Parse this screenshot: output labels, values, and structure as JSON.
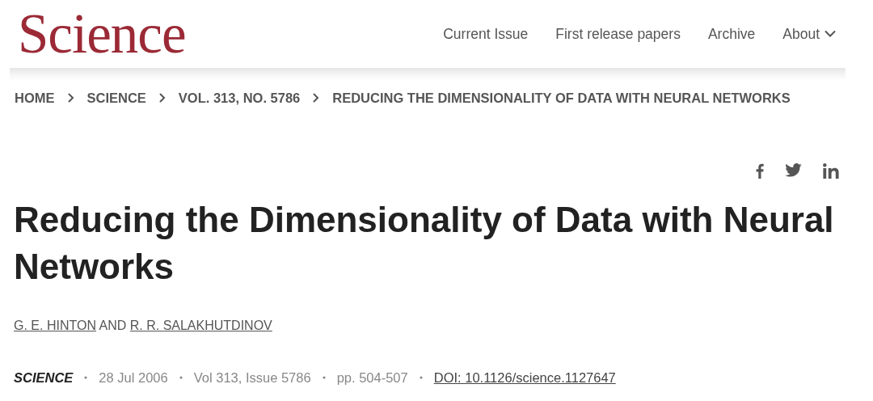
{
  "logo": "Science",
  "nav": [
    {
      "label": "Current Issue",
      "kind": "link"
    },
    {
      "label": "First release papers",
      "kind": "link"
    },
    {
      "label": "Archive",
      "kind": "link"
    },
    {
      "label": "About",
      "kind": "dropdown"
    }
  ],
  "breadcrumb": [
    "HOME",
    "SCIENCE",
    "VOL. 313, NO. 5786",
    "REDUCING THE DIMENSIONALITY OF DATA WITH NEURAL NETWORKS"
  ],
  "title": "Reducing the Dimensionality of Data with Neural Networks",
  "authors": {
    "names": [
      "G. E. HINTON",
      "R. R. SALAKHUTDINOV"
    ],
    "joiner": "AND"
  },
  "meta": {
    "journal": "SCIENCE",
    "items": [
      "28 Jul 2006",
      "Vol 313, Issue 5786",
      "pp. 504-507"
    ],
    "doi": "DOI: 10.1126/science.1127647"
  }
}
